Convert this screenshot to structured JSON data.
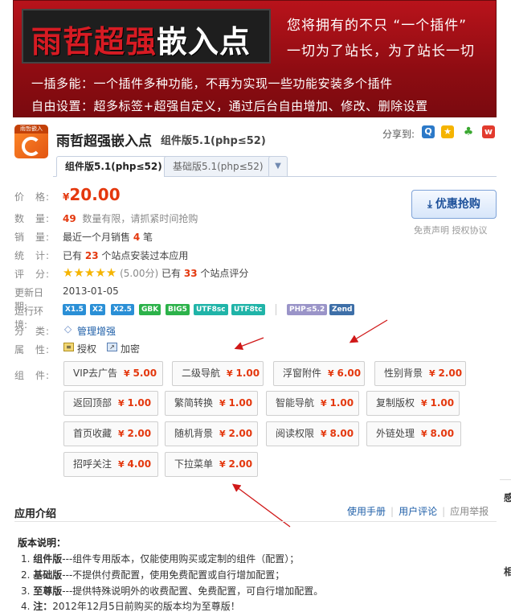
{
  "banner": {
    "title_red": "雨哲超强",
    "title_white": "嵌入点",
    "slogan1": "您将拥有的不只 “一个插件”",
    "slogan2": "一切为了站长，为了站长一切",
    "line1": "一插多能：一个插件多种功能，不再为实现一些功能安装多个插件",
    "line2": "自由设置：超多标签+超强自定义，通过后台自由增加、修改、删除设置"
  },
  "logo": {
    "top_text": "雨哲嵌入"
  },
  "product": {
    "title": "雨哲超强嵌入点",
    "subtitle": "组件版5.1(php≤52)"
  },
  "share": {
    "label": "分享到:",
    "icons": [
      "qzone-icon",
      "star-icon",
      "clover-icon",
      "weibo-icon"
    ]
  },
  "tabs": [
    {
      "label": "组件版5.1(php≤52)",
      "active": true
    },
    {
      "label": "基础版5.1(php≤52)",
      "active": false
    }
  ],
  "info": {
    "price_label": "价　格:",
    "currency": "¥",
    "price": "20.00",
    "qty_label": "数　量:",
    "qty": "49",
    "qty_note": "数量有限，请抓紧时间抢购",
    "sales_label": "销　量:",
    "sales_pre": "最近一个月销售",
    "sales": "4",
    "sales_post": "笔",
    "stats_label": "统　计:",
    "stats_pre": "已有",
    "stats_num": "23",
    "stats_post": "个站点安装过本应用",
    "rating_label": "评　分:",
    "rating_score": "(5.00分)",
    "rating_pre": "已有",
    "rating_num": "33",
    "rating_post": "个站点评分",
    "stars": 5,
    "updated_label": "更新日期:",
    "updated": "2013-01-05",
    "env_label": "运行环境:",
    "category_label": "分　类:",
    "category": "管理增强",
    "attr_label": "属　性:",
    "attr1": "授权",
    "attr2": "加密",
    "comp_label": "组　件:"
  },
  "buy": {
    "button": "优惠抢购",
    "disclaimer": "免责声明",
    "license": "授权协议"
  },
  "env_badges": [
    {
      "label": "X1.5",
      "color": "#2a8fd6"
    },
    {
      "label": "X2",
      "color": "#2a8fd6"
    },
    {
      "label": "X2.5",
      "color": "#2a8fd6"
    },
    {
      "label": "GBK",
      "color": "#2cb24a"
    },
    {
      "label": "BIG5",
      "color": "#2cb24a"
    },
    {
      "label": "UTF8sc",
      "color": "#20b4a8"
    },
    {
      "label": "UTF8tc",
      "color": "#20b4a8"
    },
    {
      "label": "PHP≤5.2",
      "color": "#9a94c8"
    },
    {
      "label": "Zend",
      "color": "#3e6fa8"
    }
  ],
  "components": [
    {
      "name": "VIP去广告",
      "price": "5.00"
    },
    {
      "name": "二级导航",
      "price": "1.00"
    },
    {
      "name": "浮窗附件",
      "price": "6.00"
    },
    {
      "name": "性别背景",
      "price": "2.00"
    },
    {
      "name": "返回顶部",
      "price": "1.00"
    },
    {
      "name": "繁简转换",
      "price": "1.00"
    },
    {
      "name": "智能导航",
      "price": "1.00"
    },
    {
      "name": "复制版权",
      "price": "1.00"
    },
    {
      "name": "首页收藏",
      "price": "2.00"
    },
    {
      "name": "随机背景",
      "price": "2.00"
    },
    {
      "name": "阅读权限",
      "price": "8.00"
    },
    {
      "name": "外链处理",
      "price": "8.00"
    },
    {
      "name": "招呼关注",
      "price": "4.00"
    },
    {
      "name": "下拉菜单",
      "price": "2.00"
    }
  ],
  "intro": {
    "title": "应用介绍",
    "manual": "使用手册",
    "review": "用户评论",
    "report": "应用举报",
    "version_head": "版本说明：",
    "items": [
      {
        "num": "1.",
        "key": "组件版",
        "text": "---组件专用版本，仅能使用购买或定制的组件（配置）；"
      },
      {
        "num": "2.",
        "key": "基础版",
        "text": "---不提供付费配置，使用免费配置或自行增加配置；"
      },
      {
        "num": "3.",
        "key": "至尊版",
        "text": "---提供特殊说明外的收费配置、免费配置，可自行增加配置。"
      },
      {
        "num": "4.",
        "key": "注：",
        "text": "2012年12月5日前购买的版本均为至尊版！"
      }
    ]
  },
  "edge": {
    "char1": "感",
    "char2": "相"
  }
}
